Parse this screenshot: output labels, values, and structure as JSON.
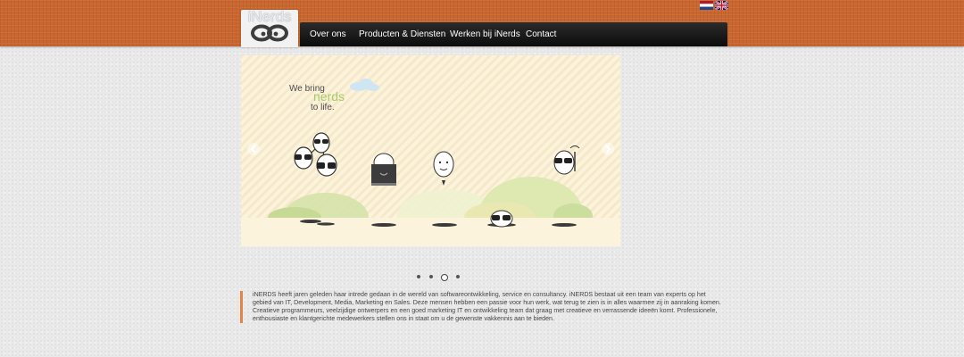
{
  "header": {
    "brand_color": "#c9662f",
    "logo_text": "iNerds",
    "flags": [
      {
        "icon": "netherlands-flag-icon",
        "colors": [
          "#ae1c28",
          "#ffffff",
          "#21468b"
        ]
      },
      {
        "icon": "united-kingdom-flag-icon",
        "colors": [
          "#012169",
          "#ffffff",
          "#c8102e"
        ]
      }
    ]
  },
  "nav": {
    "items": [
      {
        "label": "Over ons"
      },
      {
        "label": "Producten & Diensten"
      },
      {
        "label": "Werken bij iNerds"
      },
      {
        "label": "Contact"
      }
    ]
  },
  "slider": {
    "line1": "We bring",
    "line2": "nerds",
    "line3": "to life.",
    "slide_count": 4,
    "active_slide": 3,
    "prev_icon": "chevron-left-icon",
    "next_icon": "chevron-right-icon"
  },
  "intro": {
    "accent_color": "#e38346",
    "text": "iNERDS heeft jaren geleden haar intrede gedaan in de wereld van softwareontwikkeling, service en consultancy. iNERDS bestaat uit een team van experts op het gebied van IT, Development, Media, Marketing en Sales. Deze mensen hebben een passie voor hun werk, wat terug te zien is in alles waarmee zij in aanraking komen. Creatieve programmeurs, veelzijdige ontwerpers en een goed marketing IT en ontwikkeling team dat graag met creatieve en verrassende ideeën komt. Professionele, enthousiaste en klantgerichte medewerkers stellen ons in staat om u de gewenste vakkennis aan te bieden."
  }
}
